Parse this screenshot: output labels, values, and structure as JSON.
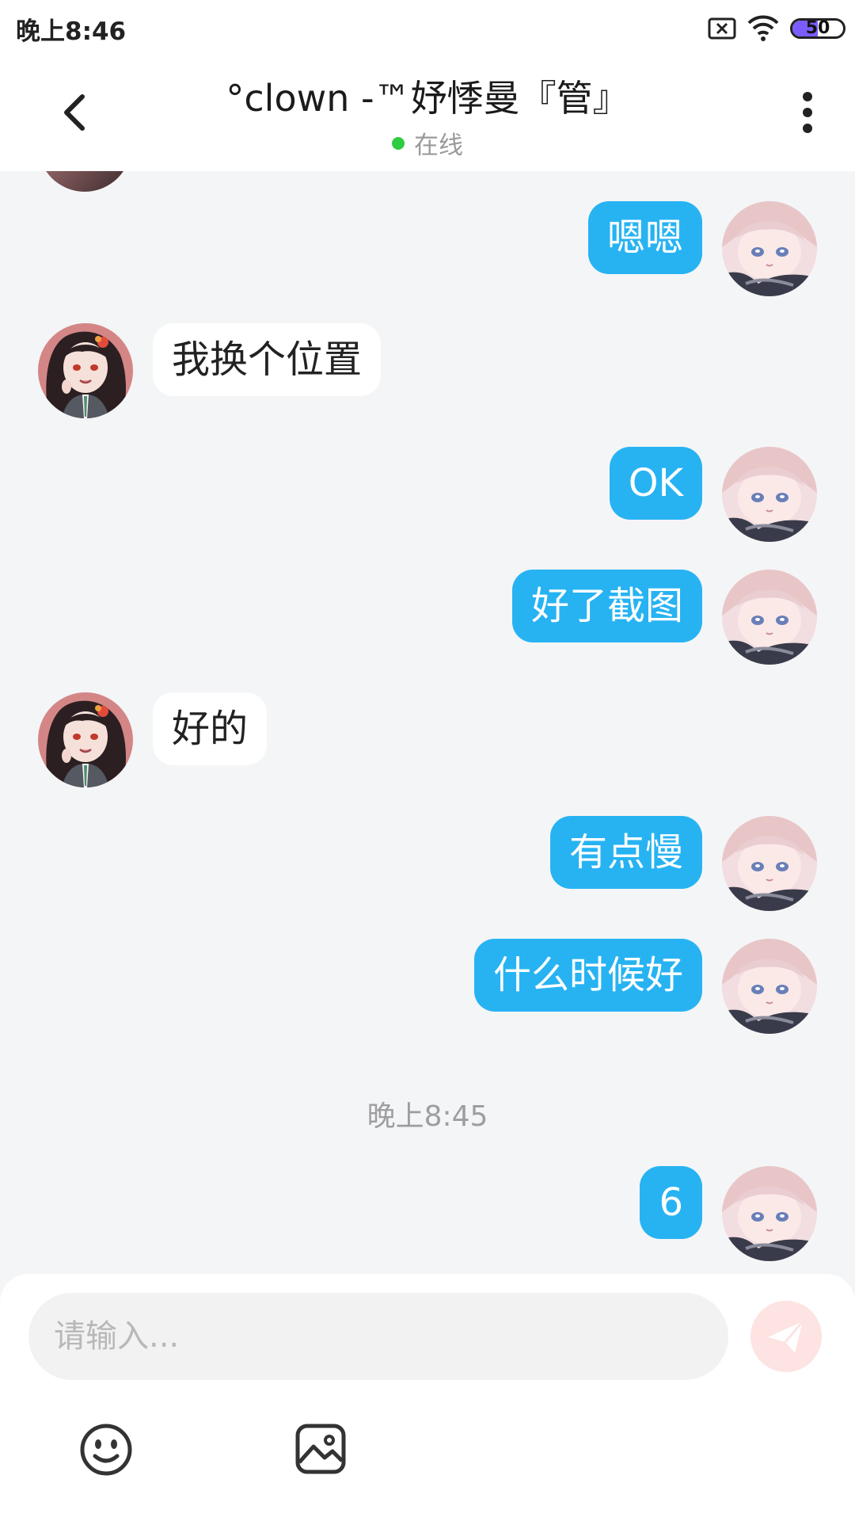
{
  "status_bar": {
    "time": "晚上8:46",
    "battery_level": "50",
    "icons": [
      "sim-blocked-icon",
      "wifi-icon",
      "battery-icon"
    ]
  },
  "header": {
    "title": "°clown -™妤悸曼『管』",
    "status": "在线",
    "status_color": "#2ecc40",
    "icons": [
      "back-arrow-icon",
      "more-vert-icon"
    ]
  },
  "messages": [
    {
      "sender": "self",
      "text": "嗯嗯"
    },
    {
      "sender": "other",
      "text": "我换个位置"
    },
    {
      "sender": "self",
      "text": "OK"
    },
    {
      "sender": "self",
      "text": "好了截图"
    },
    {
      "sender": "other",
      "text": "好的"
    },
    {
      "sender": "self",
      "text": "有点慢"
    },
    {
      "sender": "self",
      "text": "什么时候好"
    },
    {
      "sender": "self",
      "text": "6"
    }
  ],
  "timestamp": "晚上8:45",
  "input": {
    "placeholder": "请输入...",
    "value": ""
  },
  "toolbar": {
    "icons": [
      "emoji-icon",
      "image-icon",
      "send-icon"
    ]
  },
  "colors": {
    "self_bubble": "#27b3f2",
    "other_bubble": "#ffffff",
    "background": "#f4f5f7",
    "send_button": "#fde3e1"
  }
}
